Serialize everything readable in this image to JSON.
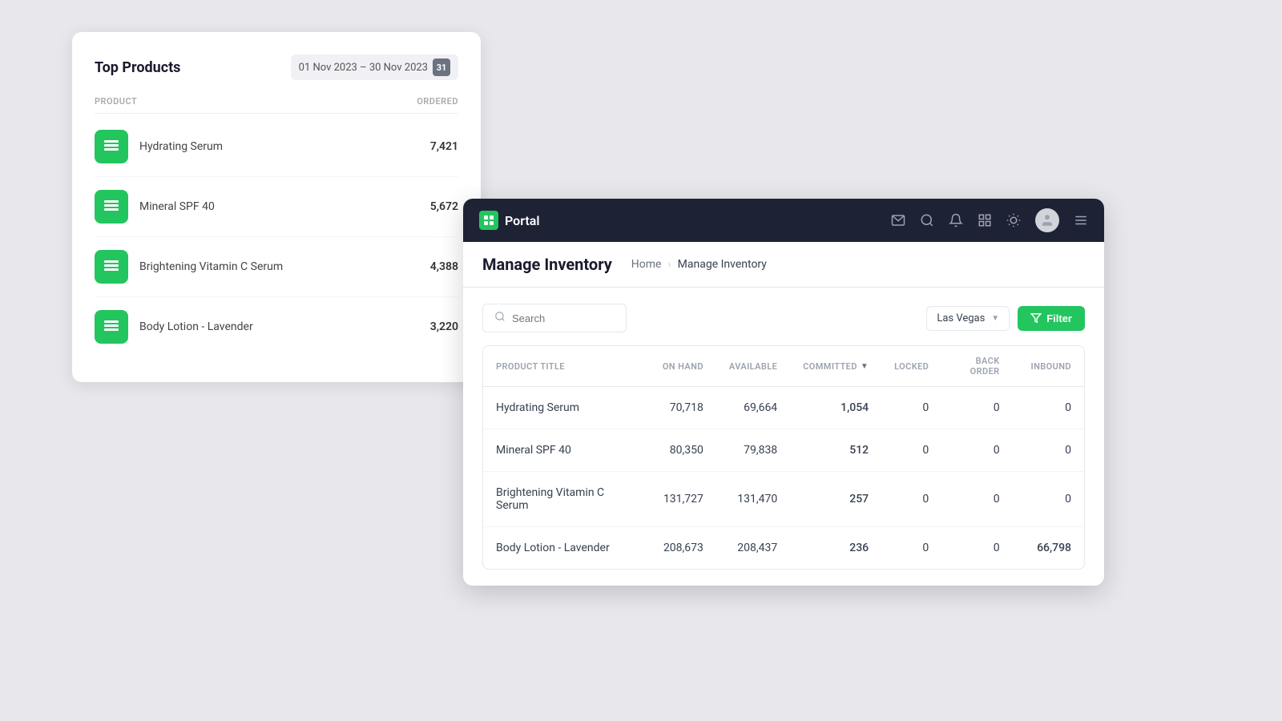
{
  "topProducts": {
    "title": "Top Products",
    "dateRange": "01 Nov 2023 – 30 Nov 2023",
    "calDay": "31",
    "headers": {
      "product": "PRODUCT",
      "ordered": "ORDERED"
    },
    "items": [
      {
        "name": "Hydrating Serum",
        "ordered": "7,421"
      },
      {
        "name": "Mineral SPF 40",
        "ordered": "5,672"
      },
      {
        "name": "Brightening Vitamin C Serum",
        "ordered": "4,388"
      },
      {
        "name": "Body Lotion - Lavender",
        "ordered": "3,220"
      }
    ]
  },
  "navbar": {
    "brandName": "Portal"
  },
  "breadcrumb": {
    "home": "Home",
    "current": "Manage Inventory"
  },
  "pageTitle": "Manage Inventory",
  "toolbar": {
    "searchPlaceholder": "Search",
    "location": "Las Vegas",
    "filterLabel": "Filter"
  },
  "table": {
    "headers": {
      "productTitle": "PRODUCT TITLE",
      "onHand": "ON HAND",
      "available": "AVAILABLE",
      "committed": "COMMITTED",
      "locked": "LOCKED",
      "backOrder": "BACK ORDER",
      "inbound": "INBOUND"
    },
    "rows": [
      {
        "name": "Hydrating Serum",
        "onHand": "70,718",
        "available": "69,664",
        "committed": "1,054",
        "locked": "0",
        "backOrder": "0",
        "inbound": "0",
        "committedGreen": true,
        "inboundGreen": false
      },
      {
        "name": "Mineral SPF 40",
        "onHand": "80,350",
        "available": "79,838",
        "committed": "512",
        "locked": "0",
        "backOrder": "0",
        "inbound": "0",
        "committedGreen": true,
        "inboundGreen": false
      },
      {
        "name": "Brightening Vitamin C Serum",
        "onHand": "131,727",
        "available": "131,470",
        "committed": "257",
        "locked": "0",
        "backOrder": "0",
        "inbound": "0",
        "committedGreen": true,
        "inboundGreen": false
      },
      {
        "name": "Body Lotion - Lavender",
        "onHand": "208,673",
        "available": "208,437",
        "committed": "236",
        "locked": "0",
        "backOrder": "0",
        "inbound": "66,798",
        "committedGreen": true,
        "inboundGreen": true
      }
    ]
  }
}
